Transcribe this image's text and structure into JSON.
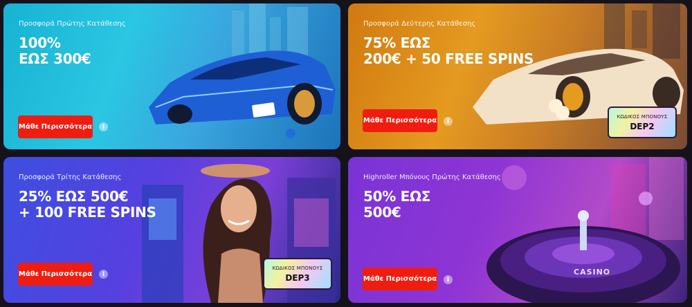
{
  "cards": [
    {
      "subtitle": "Προσφορά Πρώτης Κατάθεσης",
      "title_line1": "100%",
      "title_line2": "ΕΩΣ 300€",
      "button_label": "Μάθε Περισσότερα",
      "info_icon": "i",
      "image": "blue-sports-car"
    },
    {
      "subtitle": "Προσφορά Δεύτερης Κατάθεσης",
      "title_line1": "75% ΕΩΣ",
      "title_line2": "200€ + 50 FREE SPINS",
      "button_label": "Μάθε Περισσότερα",
      "info_icon": "i",
      "code_label": "ΚΩΔΙΚΟΣ ΜΠΟΝΟΥΣ",
      "code_value": "DEP2",
      "image": "white-sports-car"
    },
    {
      "subtitle": "Προσφορά Τρίτης Κατάθεσης",
      "title_line1": "25% ΕΩΣ 500€",
      "title_line2": "+ 100 FREE SPINS",
      "button_label": "Μάθε Περισσότερα",
      "info_icon": "i",
      "code_label": "ΚΩΔΙΚΟΣ ΜΠΟΝΟΥΣ",
      "code_value": "DEP3",
      "image": "smiling-woman-slot-machines"
    },
    {
      "subtitle": "Highroller Μπόνους Πρώτης Κατάθεσης",
      "title_line1": "50% ΕΩΣ",
      "title_line2": "500€",
      "button_label": "Μάθε Περισσότερα",
      "info_icon": "i",
      "roulette_text": "CASINO",
      "image": "roulette-wheel"
    }
  ],
  "colors": {
    "button": "#ef1d10",
    "text": "#ffffff"
  }
}
